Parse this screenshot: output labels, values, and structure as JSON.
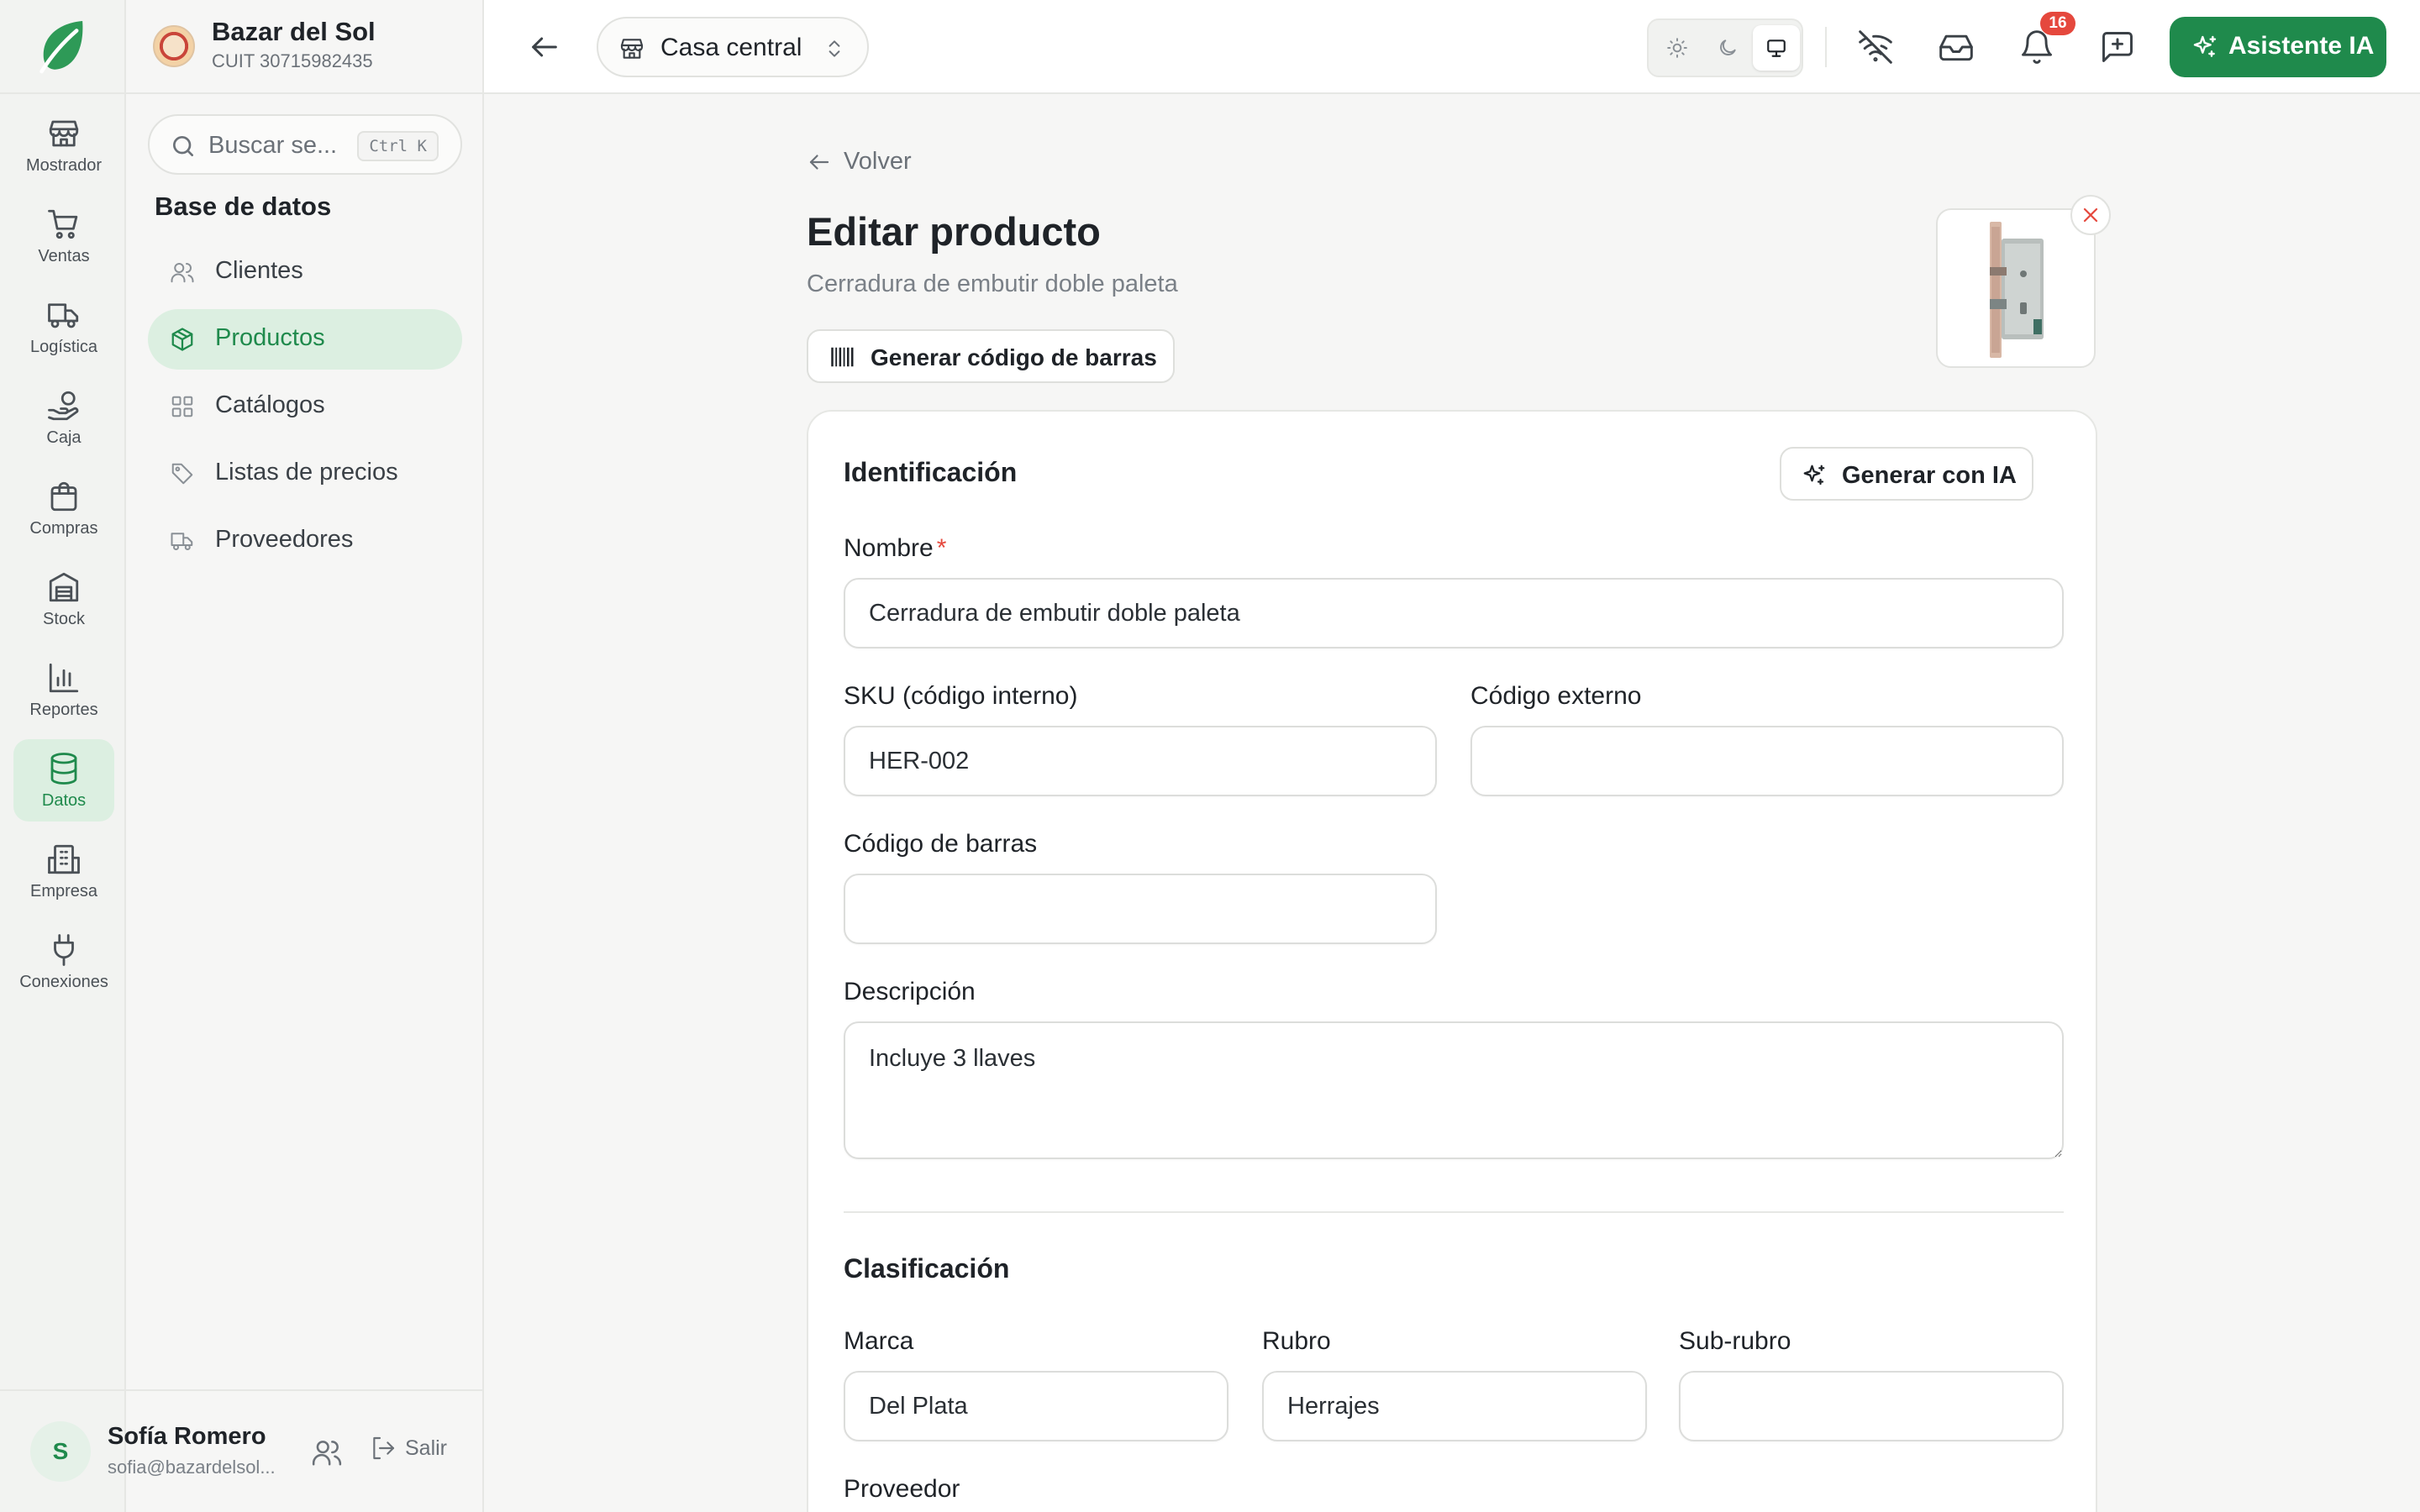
{
  "business": {
    "name": "Bazar del Sol",
    "cuit": "CUIT 30715982435"
  },
  "rail": [
    {
      "label": "Mostrador",
      "icon": "storefront-icon",
      "active": false
    },
    {
      "label": "Ventas",
      "icon": "cart-icon",
      "active": false
    },
    {
      "label": "Logística",
      "icon": "truck-icon",
      "active": false
    },
    {
      "label": "Caja",
      "icon": "hand-coins-icon",
      "active": false
    },
    {
      "label": "Compras",
      "icon": "shopping-bag-icon",
      "active": false
    },
    {
      "label": "Stock",
      "icon": "warehouse-icon",
      "active": false
    },
    {
      "label": "Reportes",
      "icon": "bar-chart-icon",
      "active": false
    },
    {
      "label": "Datos",
      "icon": "database-icon",
      "active": true
    },
    {
      "label": "Empresa",
      "icon": "building-icon",
      "active": false
    },
    {
      "label": "Conexiones",
      "icon": "plug-icon",
      "active": false
    }
  ],
  "sidebar": {
    "search_placeholder": "Buscar se...",
    "search_shortcut": "Ctrl K",
    "section_title": "Base de datos",
    "items": [
      {
        "label": "Clientes",
        "icon": "users-icon",
        "active": false
      },
      {
        "label": "Productos",
        "icon": "package-icon",
        "active": true
      },
      {
        "label": "Catálogos",
        "icon": "grid-icon",
        "active": false
      },
      {
        "label": "Listas de precios",
        "icon": "tag-icon",
        "active": false
      },
      {
        "label": "Proveedores",
        "icon": "truck-icon",
        "active": false
      }
    ]
  },
  "user": {
    "initial": "S",
    "name": "Sofía Romero",
    "email": "sofia@bazardelsol...",
    "logout_label": "Salir"
  },
  "topbar": {
    "branch": "Casa central",
    "notifications_count": "16",
    "ai_button": "Asistente IA",
    "theme": "system"
  },
  "page": {
    "back_label": "Volver",
    "title": "Editar producto",
    "subtitle": "Cerradura de embutir doble paleta",
    "barcode_button": "Generar código de barras"
  },
  "form": {
    "identification": {
      "title": "Identificación",
      "generate_button": "Generar con IA",
      "name_label": "Nombre",
      "name_required": "*",
      "name_value": "Cerradura de embutir doble paleta",
      "sku_label": "SKU (código interno)",
      "sku_value": "HER-002",
      "external_code_label": "Código externo",
      "external_code_value": "",
      "barcode_label": "Código de barras",
      "barcode_value": "",
      "description_label": "Descripción",
      "description_value": "Incluye 3 llaves"
    },
    "classification": {
      "title": "Clasificación",
      "brand_label": "Marca",
      "brand_value": "Del Plata",
      "category_label": "Rubro",
      "category_value": "Herrajes",
      "subcategory_label": "Sub-rubro",
      "subcategory_value": "",
      "supplier_label": "Proveedor"
    }
  },
  "colors": {
    "accent": "#1f8a4c",
    "accent_soft": "#dcefe1",
    "danger": "#e5483d"
  }
}
